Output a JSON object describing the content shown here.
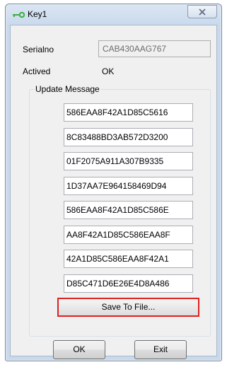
{
  "window": {
    "title": "Key1"
  },
  "fields": {
    "serial_label": "Serialno",
    "serial_value": "CAB430AAG767",
    "actived_label": "Actived",
    "actived_value": "OK"
  },
  "update_group": {
    "label": "Update Message",
    "messages": [
      "586EAA8F42A1D85C5616",
      "8C83488BD3AB572D3200",
      "01F2075A911A307B9335",
      "1D37AA7E964158469D94",
      "586EAA8F42A1D85C586E",
      "AA8F42A1D85C586EAA8F",
      "42A1D85C586EAA8F42A1",
      "D85C471D6E26E4D8A486"
    ],
    "save_button": "Save To File..."
  },
  "buttons": {
    "ok": "OK",
    "exit": "Exit"
  },
  "colors": {
    "highlight": "#e02020",
    "key_icon": "#3cb043"
  }
}
